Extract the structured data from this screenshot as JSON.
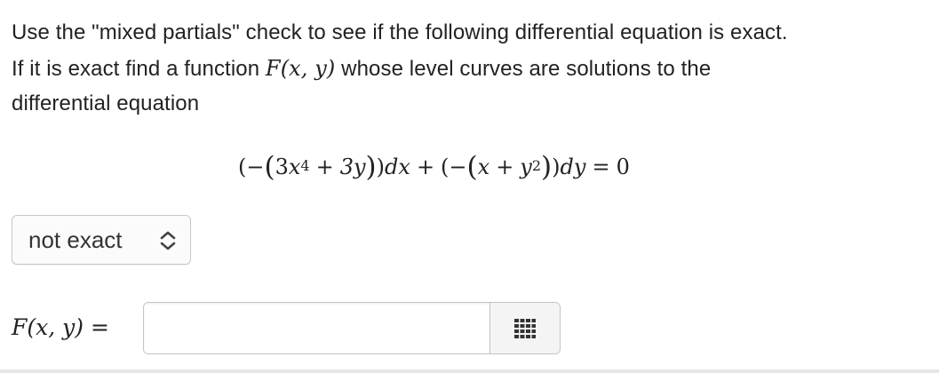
{
  "prompt": {
    "line1": "Use the \"mixed partials\" check to see if the following differential equation is exact.",
    "line2_before": "If it is exact find a function ",
    "line2_math_F": "F",
    "line2_math_args": "(x, y)",
    "line2_after": " whose level curves are solutions to the",
    "line3": "differential equation"
  },
  "equation": {
    "open1": "(−",
    "open2": "(",
    "term1_coef": "3",
    "term1_var": "x",
    "term1_exp": "4",
    "plus1": "+",
    "term2": "3y",
    "close2": ")",
    "close1": ")",
    "dx": "dx",
    "plus2": "+",
    "open3": "(−",
    "open4": "(",
    "term3": "x",
    "plus3": "+",
    "term4_var": "y",
    "term4_exp": "2",
    "close4": ")",
    "close3": ")",
    "dy": "dy",
    "equals": "=",
    "rhs": "0"
  },
  "exactness_select": {
    "selected": "not exact",
    "icon": "chevron-up-down-icon"
  },
  "answer": {
    "label_F": "F",
    "label_args": "(x, y)",
    "label_equals": "=",
    "value": "",
    "keypad_icon": "keypad-grid-icon"
  }
}
